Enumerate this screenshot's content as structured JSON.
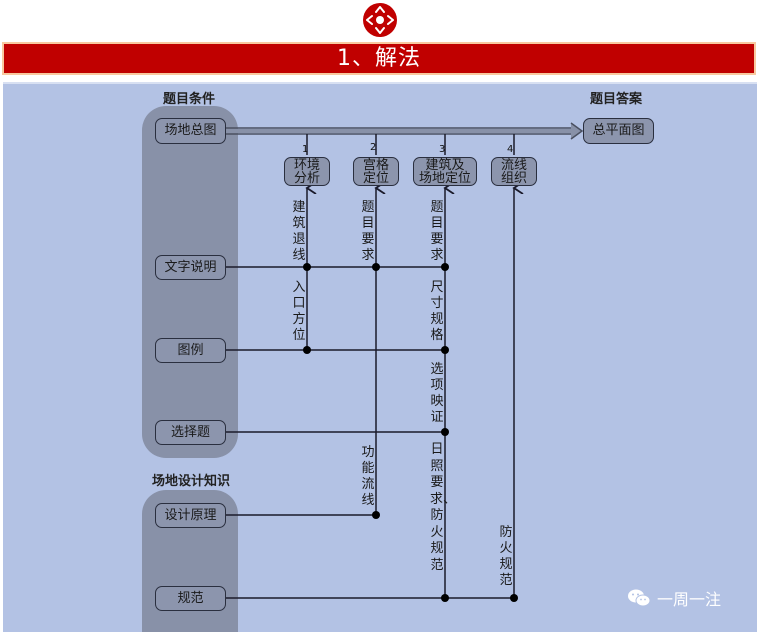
{
  "header": {
    "logo_icon": "compass-arrows-icon",
    "title": "1、解法",
    "brand_color": "#c00000"
  },
  "diagram": {
    "left_group_label": "题目条件",
    "right_label": "题目答案",
    "knowledge_group_label": "场地设计知识",
    "inputs": [
      {
        "id": "site_plan",
        "label": "场地总图"
      },
      {
        "id": "text_desc",
        "label": "文字说明"
      },
      {
        "id": "legend",
        "label": "图例"
      },
      {
        "id": "choice",
        "label": "选择题"
      },
      {
        "id": "design_principle",
        "label": "设计原理"
      },
      {
        "id": "norms",
        "label": "规范"
      }
    ],
    "output": {
      "label": "总平面图"
    },
    "steps": [
      {
        "num": "1",
        "label_line1": "环境",
        "label_line2": "分析"
      },
      {
        "num": "2",
        "label_line1": "宫格",
        "label_line2": "定位"
      },
      {
        "num": "3",
        "label_line1": "建筑及",
        "label_line2": "场地定位"
      },
      {
        "num": "4",
        "label_line1": "流线",
        "label_line2": "组织"
      }
    ],
    "edge_labels": {
      "s1_text": "建筑退线",
      "s1_legend": "入口方位",
      "s2_text": "题目要求",
      "s2_design": "功能流线",
      "s3_text": "题目要求",
      "s3_legend": "尺寸规格",
      "s3_choice": "选项映证",
      "s3_norms": "日照要求、防火规范",
      "s4_norms": "防火规范"
    }
  },
  "watermark": {
    "icon": "wechat-icon",
    "text": "一周一注"
  }
}
